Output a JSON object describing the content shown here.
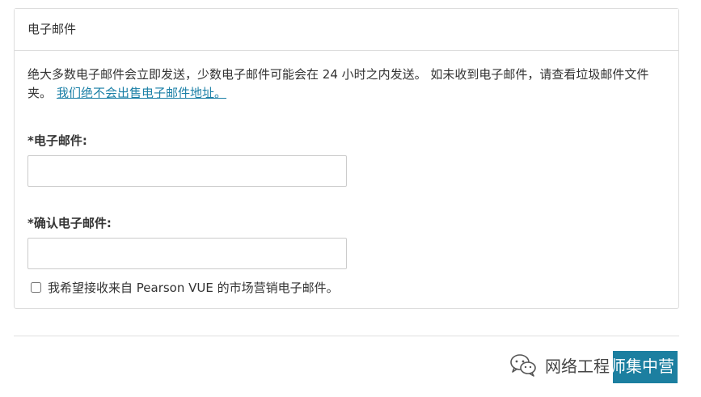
{
  "panel": {
    "heading": "电子邮件",
    "intro_text": "绝大多数电子邮件会立即发送，少数电子邮件可能会在 24 小时之内发送。 如未收到电子邮件，请查看垃圾邮件文件夹。",
    "intro_link": "我们绝不会出售电子邮件地址。",
    "email_label": "*电子邮件:",
    "email_value": "",
    "confirm_label": "*确认电子邮件:",
    "confirm_value": "",
    "marketing_label": "我希望接收来自 Pearson VUE 的市场营销电子邮件。",
    "marketing_checked": false
  },
  "watermark": {
    "text_part1": "网络工程",
    "text_part2": "师集中营"
  },
  "colors": {
    "link": "#1a7fa6",
    "button": "#1c7fa0",
    "border": "#dddddd"
  },
  "icons": {
    "watermark_icon": "wechat-icon"
  }
}
